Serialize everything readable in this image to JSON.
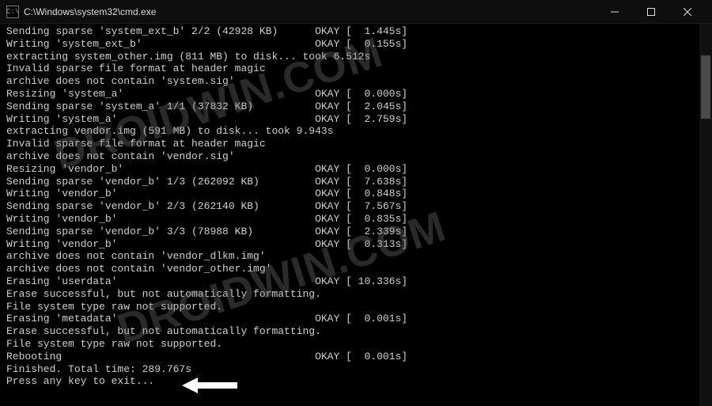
{
  "window": {
    "title": "C:\\Windows\\system32\\cmd.exe",
    "icon_label": "C:\\"
  },
  "watermark": "DROIDWIN.COM",
  "lines": [
    {
      "text": "Sending sparse 'system_ext_b' 2/2 (42928 KB)",
      "status": "OKAY",
      "time": "1.445s"
    },
    {
      "text": "Writing 'system_ext_b'",
      "status": "OKAY",
      "time": "0.155s"
    },
    {
      "text": "extracting system_other.img (811 MB) to disk... took 6.512s"
    },
    {
      "text": "Invalid sparse file format at header magic"
    },
    {
      "text": "archive does not contain 'system.sig'"
    },
    {
      "text": "Resizing 'system_a'",
      "status": "OKAY",
      "time": "0.000s"
    },
    {
      "text": "Sending sparse 'system_a' 1/1 (37832 KB)",
      "status": "OKAY",
      "time": "2.045s"
    },
    {
      "text": "Writing 'system_a'",
      "status": "OKAY",
      "time": "2.759s"
    },
    {
      "text": "extracting vendor.img (591 MB) to disk... took 9.943s"
    },
    {
      "text": "Invalid sparse file format at header magic"
    },
    {
      "text": "archive does not contain 'vendor.sig'"
    },
    {
      "text": "Resizing 'vendor_b'",
      "status": "OKAY",
      "time": "0.000s"
    },
    {
      "text": "Sending sparse 'vendor_b' 1/3 (262092 KB)",
      "status": "OKAY",
      "time": "7.638s"
    },
    {
      "text": "Writing 'vendor_b'",
      "status": "OKAY",
      "time": "0.848s"
    },
    {
      "text": "Sending sparse 'vendor_b' 2/3 (262140 KB)",
      "status": "OKAY",
      "time": "7.567s"
    },
    {
      "text": "Writing 'vendor_b'",
      "status": "OKAY",
      "time": "0.835s"
    },
    {
      "text": "Sending sparse 'vendor_b' 3/3 (78988 KB)",
      "status": "OKAY",
      "time": "2.339s"
    },
    {
      "text": "Writing 'vendor_b'",
      "status": "OKAY",
      "time": "0.313s"
    },
    {
      "text": "archive does not contain 'vendor_dlkm.img'"
    },
    {
      "text": "archive does not contain 'vendor_other.img'"
    },
    {
      "text": "Erasing 'userdata'",
      "status": "OKAY",
      "time": "10.336s"
    },
    {
      "text": "Erase successful, but not automatically formatting."
    },
    {
      "text": "File system type raw not supported."
    },
    {
      "text": "Erasing 'metadata'",
      "status": "OKAY",
      "time": "0.001s"
    },
    {
      "text": "Erase successful, but not automatically formatting."
    },
    {
      "text": "File system type raw not supported."
    },
    {
      "text": "Rebooting",
      "status": "OKAY",
      "time": "0.001s"
    },
    {
      "text": "Finished. Total time: 289.767s"
    },
    {
      "text": "Press any key to exit..."
    }
  ]
}
